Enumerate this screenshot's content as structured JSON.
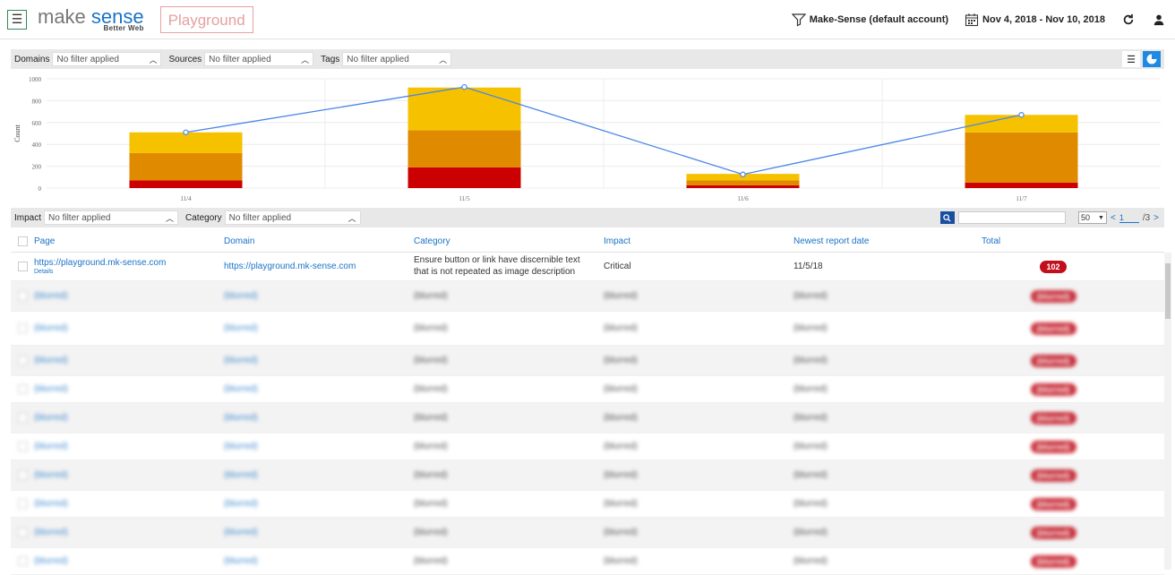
{
  "header": {
    "logo_make": "make",
    "logo_sense": "sense",
    "logo_tagline": "Better Web",
    "badge": "Playground",
    "account": "Make-Sense (default account)",
    "date_range": "Nov 4, 2018 - Nov 10, 2018"
  },
  "filters_top": {
    "domains_label": "Domains",
    "domains_value": "No filter applied",
    "sources_label": "Sources",
    "sources_value": "No filter applied",
    "tags_label": "Tags",
    "tags_value": "No filter applied"
  },
  "filters_bottom": {
    "impact_label": "Impact",
    "impact_value": "No filter applied",
    "category_label": "Category",
    "category_value": "No filter applied",
    "page_size": "50",
    "page_prev": "<",
    "page_current": "1",
    "page_total": "/3",
    "page_next": ">"
  },
  "chart_data": {
    "type": "bar",
    "ylabel": "Count",
    "ylim": [
      0,
      1000
    ],
    "yticks": [
      "0",
      "200",
      "400",
      "600",
      "800",
      "1000"
    ],
    "categories": [
      "11/4",
      "11/5",
      "11/6",
      "11/7"
    ],
    "series": [
      {
        "color": "#cc0000",
        "values": [
          70,
          190,
          25,
          50
        ]
      },
      {
        "color": "#e08a00",
        "values": [
          250,
          340,
          45,
          460
        ]
      },
      {
        "color": "#f6c200",
        "values": [
          190,
          390,
          60,
          160
        ]
      }
    ],
    "line": {
      "color": "#4a86e8",
      "values": [
        510,
        925,
        125,
        670
      ]
    }
  },
  "table": {
    "headers": [
      "Page",
      "Domain",
      "Category",
      "Impact",
      "Newest report date",
      "Total"
    ],
    "first_row": {
      "page": "https://playground.mk-sense.com",
      "details": "Details",
      "domain": "https://playground.mk-sense.com",
      "category": "Ensure button or link have discernible text that is not repeated as image description",
      "impact": "Critical",
      "date": "11/5/18",
      "total": "102"
    },
    "blurred_rows": [
      {
        "page": "(blurred)",
        "domain": "(blurred)",
        "category": "(blurred)",
        "impact": "(blurred)",
        "date": "(blurred)",
        "total": "(blurred)"
      },
      {
        "page": "(blurred)",
        "domain": "(blurred)",
        "category": "(blurred)",
        "impact": "(blurred)",
        "date": "(blurred)",
        "total": "(blurred)"
      },
      {
        "page": "(blurred)",
        "domain": "(blurred)",
        "category": "(blurred)",
        "impact": "(blurred)",
        "date": "(blurred)",
        "total": "(blurred)"
      },
      {
        "page": "(blurred)",
        "domain": "(blurred)",
        "category": "(blurred)",
        "impact": "(blurred)",
        "date": "(blurred)",
        "total": "(blurred)"
      },
      {
        "page": "(blurred)",
        "domain": "(blurred)",
        "category": "(blurred)",
        "impact": "(blurred)",
        "date": "(blurred)",
        "total": "(blurred)"
      },
      {
        "page": "(blurred)",
        "domain": "(blurred)",
        "category": "(blurred)",
        "impact": "(blurred)",
        "date": "(blurred)",
        "total": "(blurred)"
      },
      {
        "page": "(blurred)",
        "domain": "(blurred)",
        "category": "(blurred)",
        "impact": "(blurred)",
        "date": "(blurred)",
        "total": "(blurred)"
      },
      {
        "page": "(blurred)",
        "domain": "(blurred)",
        "category": "(blurred)",
        "impact": "(blurred)",
        "date": "(blurred)",
        "total": "(blurred)"
      },
      {
        "page": "(blurred)",
        "domain": "(blurred)",
        "category": "(blurred)",
        "impact": "(blurred)",
        "date": "(blurred)",
        "total": "(blurred)"
      },
      {
        "page": "(blurred)",
        "domain": "(blurred)",
        "category": "(blurred)",
        "impact": "(blurred)",
        "date": "(blurred)",
        "total": "(blurred)"
      }
    ]
  },
  "icons": {
    "menu": "menu-icon",
    "filter": "filter-icon",
    "calendar": "calendar-icon",
    "refresh": "refresh-icon",
    "user": "user-icon",
    "list_view": "list-view-icon",
    "chart_view": "pie-chart-icon",
    "search": "search-icon"
  }
}
